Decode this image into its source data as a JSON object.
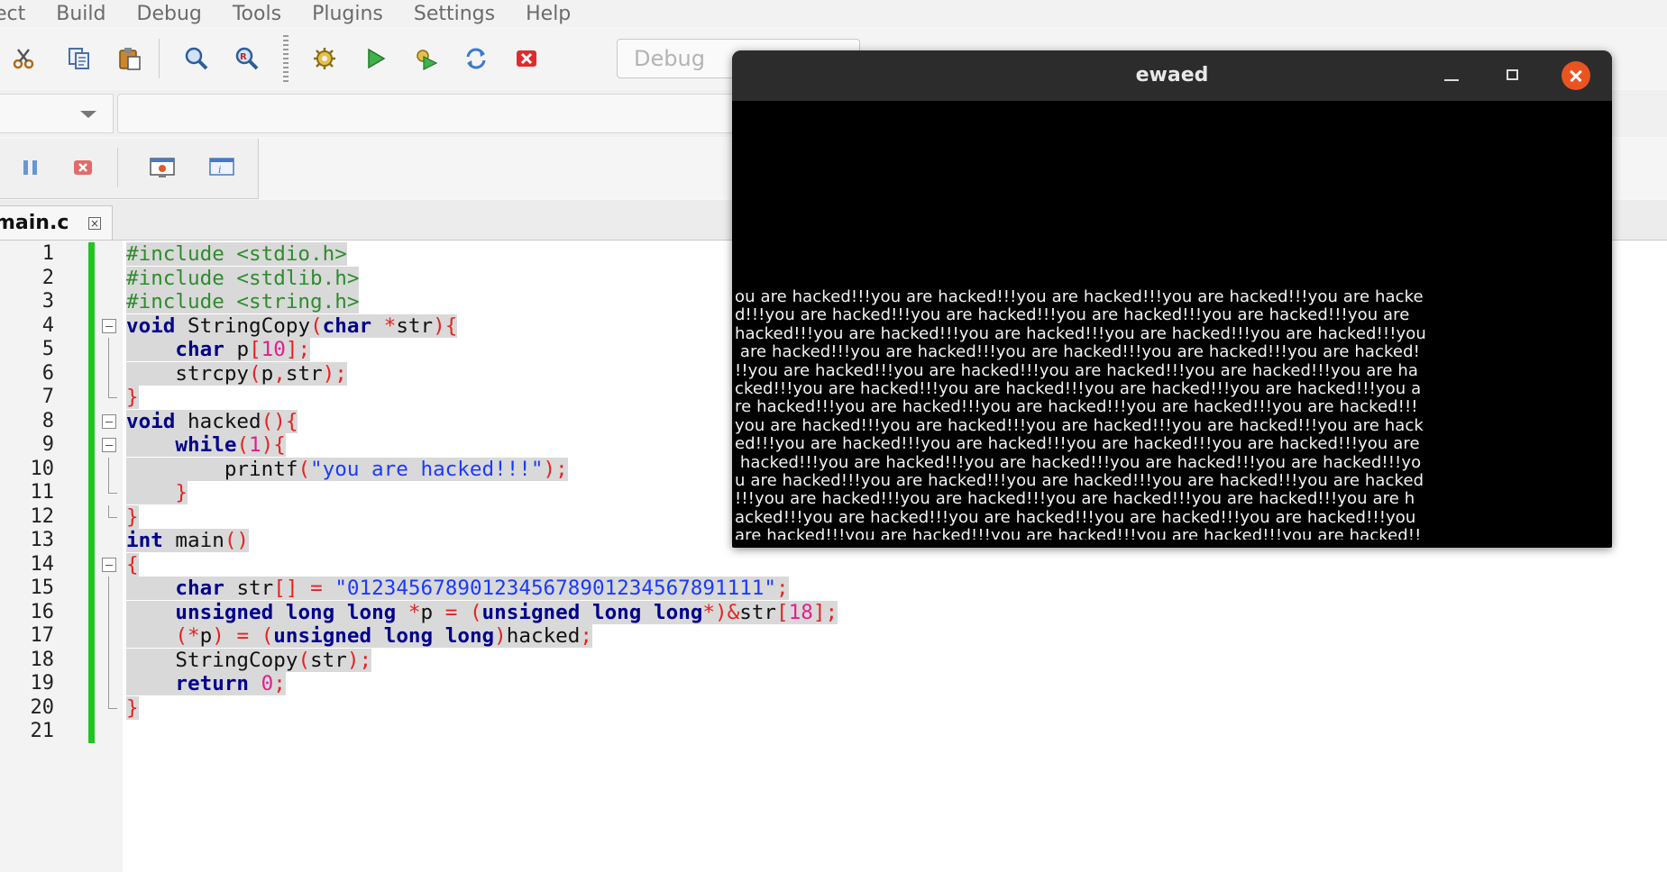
{
  "menu": [
    "ect",
    "Build",
    "Debug",
    "Tools",
    "Plugins",
    "Settings",
    "Help"
  ],
  "toolbar": {
    "build_target": "Debug",
    "icons": [
      "cut-icon",
      "copy-icon",
      "paste-icon",
      "find-icon",
      "replace-icon",
      "build-icon",
      "run-icon",
      "build-run-icon",
      "rebuild-icon",
      "abort-icon"
    ]
  },
  "debug_toolbar": {
    "icons": [
      "pause-icon",
      "stop-debug-icon",
      "debug-window-icon",
      "info-window-icon"
    ]
  },
  "editor": {
    "tab": {
      "filename": "main.c"
    },
    "lines": [
      {
        "n": "1",
        "segs": [
          {
            "t": "#include <stdio.h>",
            "c": "pp"
          }
        ]
      },
      {
        "n": "2",
        "segs": [
          {
            "t": "#include <stdlib.h>",
            "c": "pp"
          }
        ]
      },
      {
        "n": "3",
        "segs": [
          {
            "t": "#include <string.h>",
            "c": "pp"
          }
        ]
      },
      {
        "n": "4",
        "fold": "start",
        "segs": [
          {
            "t": "void",
            "c": "k"
          },
          {
            "t": " StringCopy"
          },
          {
            "t": "(",
            "c": "o"
          },
          {
            "t": "char",
            "c": "k"
          },
          {
            "t": " "
          },
          {
            "t": "*",
            "c": "o"
          },
          {
            "t": "str"
          },
          {
            "t": "){",
            "c": "o"
          }
        ]
      },
      {
        "n": "5",
        "fold": "line",
        "segs": [
          {
            "t": "    "
          },
          {
            "t": "char",
            "c": "k"
          },
          {
            "t": " p"
          },
          {
            "t": "[",
            "c": "o"
          },
          {
            "t": "10",
            "c": "n"
          },
          {
            "t": "];",
            "c": "o"
          }
        ]
      },
      {
        "n": "6",
        "fold": "line",
        "segs": [
          {
            "t": "    strcpy"
          },
          {
            "t": "(",
            "c": "o"
          },
          {
            "t": "p"
          },
          {
            "t": ",",
            "c": "o"
          },
          {
            "t": "str"
          },
          {
            "t": ");",
            "c": "o"
          }
        ]
      },
      {
        "n": "7",
        "fold": "end",
        "segs": [
          {
            "t": "}",
            "c": "o"
          }
        ]
      },
      {
        "n": "8",
        "fold": "start",
        "segs": [
          {
            "t": "void",
            "c": "k"
          },
          {
            "t": " hacked"
          },
          {
            "t": "(){",
            "c": "o"
          }
        ]
      },
      {
        "n": "9",
        "fold": "start",
        "segs": [
          {
            "t": "    "
          },
          {
            "t": "while",
            "c": "k"
          },
          {
            "t": "(",
            "c": "o"
          },
          {
            "t": "1",
            "c": "n"
          },
          {
            "t": "){",
            "c": "o"
          }
        ]
      },
      {
        "n": "10",
        "fold": "line",
        "segs": [
          {
            "t": "        printf"
          },
          {
            "t": "(",
            "c": "o"
          },
          {
            "t": "\"you are hacked!!!\"",
            "c": "s"
          },
          {
            "t": ");",
            "c": "o"
          }
        ]
      },
      {
        "n": "11",
        "fold": "end",
        "segs": [
          {
            "t": "    "
          },
          {
            "t": "}",
            "c": "o"
          }
        ]
      },
      {
        "n": "12",
        "fold": "end",
        "segs": [
          {
            "t": "}",
            "c": "o"
          }
        ]
      },
      {
        "n": "13",
        "segs": [
          {
            "t": "int",
            "c": "k"
          },
          {
            "t": " main"
          },
          {
            "t": "()",
            "c": "o"
          }
        ]
      },
      {
        "n": "14",
        "fold": "start",
        "segs": [
          {
            "t": "{",
            "c": "o"
          }
        ]
      },
      {
        "n": "15",
        "fold": "line",
        "segs": [
          {
            "t": "    "
          },
          {
            "t": "char",
            "c": "k"
          },
          {
            "t": " str"
          },
          {
            "t": "[]",
            "c": "o"
          },
          {
            "t": " "
          },
          {
            "t": "=",
            "c": "o"
          },
          {
            "t": " "
          },
          {
            "t": "\"0123456789012345678901234567891111\"",
            "c": "s"
          },
          {
            "t": ";",
            "c": "o"
          }
        ]
      },
      {
        "n": "16",
        "fold": "line",
        "segs": [
          {
            "t": "    "
          },
          {
            "t": "unsigned long long",
            "c": "k"
          },
          {
            "t": " "
          },
          {
            "t": "*",
            "c": "o"
          },
          {
            "t": "p "
          },
          {
            "t": "=",
            "c": "o"
          },
          {
            "t": " "
          },
          {
            "t": "(",
            "c": "o"
          },
          {
            "t": "unsigned long long",
            "c": "k"
          },
          {
            "t": "*)&",
            "c": "o"
          },
          {
            "t": "str"
          },
          {
            "t": "[",
            "c": "o"
          },
          {
            "t": "18",
            "c": "n"
          },
          {
            "t": "];",
            "c": "o"
          }
        ]
      },
      {
        "n": "17",
        "fold": "line",
        "segs": [
          {
            "t": "    "
          },
          {
            "t": "(*",
            "c": "o"
          },
          {
            "t": "p"
          },
          {
            "t": ")",
            "c": "o"
          },
          {
            "t": " "
          },
          {
            "t": "=",
            "c": "o"
          },
          {
            "t": " "
          },
          {
            "t": "(",
            "c": "o"
          },
          {
            "t": "unsigned long long",
            "c": "k"
          },
          {
            "t": ")",
            "c": "o"
          },
          {
            "t": "hacked"
          },
          {
            "t": ";",
            "c": "o"
          }
        ]
      },
      {
        "n": "18",
        "fold": "line",
        "segs": [
          {
            "t": "    StringCopy"
          },
          {
            "t": "(",
            "c": "o"
          },
          {
            "t": "str"
          },
          {
            "t": ");",
            "c": "o"
          }
        ]
      },
      {
        "n": "19",
        "fold": "line",
        "segs": [
          {
            "t": "    "
          },
          {
            "t": "return",
            "c": "k"
          },
          {
            "t": " "
          },
          {
            "t": "0",
            "c": "n"
          },
          {
            "t": ";",
            "c": "o"
          }
        ]
      },
      {
        "n": "20",
        "fold": "end",
        "segs": [
          {
            "t": "}",
            "c": "o"
          }
        ]
      },
      {
        "n": "21",
        "segs": []
      }
    ]
  },
  "terminal": {
    "title": "ewaed",
    "output_lines": [
      "ou are hacked!!!you are hacked!!!you are hacked!!!you are hacked!!!you are hacke",
      "d!!!you are hacked!!!you are hacked!!!you are hacked!!!you are hacked!!!you are ",
      "hacked!!!you are hacked!!!you are hacked!!!you are hacked!!!you are hacked!!!you",
      " are hacked!!!you are hacked!!!you are hacked!!!you are hacked!!!you are hacked!",
      "!!you are hacked!!!you are hacked!!!you are hacked!!!you are hacked!!!you are ha",
      "cked!!!you are hacked!!!you are hacked!!!you are hacked!!!you are hacked!!!you a",
      "re hacked!!!you are hacked!!!you are hacked!!!you are hacked!!!you are hacked!!!",
      "you are hacked!!!you are hacked!!!you are hacked!!!you are hacked!!!you are hack",
      "ed!!!you are hacked!!!you are hacked!!!you are hacked!!!you are hacked!!!you are",
      " hacked!!!you are hacked!!!you are hacked!!!you are hacked!!!you are hacked!!!yo",
      "u are hacked!!!you are hacked!!!you are hacked!!!you are hacked!!!you are hacked",
      "!!!you are hacked!!!you are hacked!!!you are hacked!!!you are hacked!!!you are h",
      "acked!!!you are hacked!!!you are hacked!!!you are hacked!!!you are hacked!!!you ",
      "are hacked!!!you are hacked!!!you are hacked!!!you are hacked!!!you are hacked!!"
    ]
  },
  "colors": {
    "change_bar": "#21c521",
    "keyword": "#00008b",
    "preprocessor": "#2e8b2e",
    "string": "#1a3aff",
    "number": "#e0208c",
    "operator": "#e62222",
    "close_button": "#e95420"
  }
}
